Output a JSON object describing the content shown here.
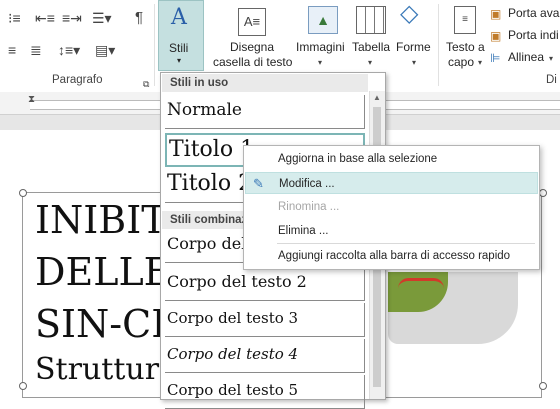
{
  "ribbon": {
    "paragraph_group_label": "Paragrafo",
    "stili_label": "Stili",
    "disegna_label_1": "Disegna",
    "disegna_label_2": "casella di testo",
    "immagini_label": "Immagini",
    "tabella_label": "Tabella",
    "forme_label": "Forme",
    "testo_label_1": "Testo a",
    "testo_label_2": "capo",
    "porta_avanti_label": "Porta avar",
    "porta_indietro_label": "Porta indi",
    "allinea_label": "Allinea",
    "pilcrow": "¶",
    "cut_group_label": "Di"
  },
  "styles_menu": {
    "section_in_use": "Stili in uso",
    "section_combined": "Stili combinaz",
    "items": [
      {
        "label": "Normale"
      },
      {
        "label": "Titolo 1"
      },
      {
        "label": "Titolo 2"
      },
      {
        "label": "Corpo del te"
      },
      {
        "label": "Corpo del testo 2"
      },
      {
        "label": "Corpo del testo 3"
      },
      {
        "label": "Corpo del testo 4"
      },
      {
        "label": "Corpo del testo 5"
      }
    ]
  },
  "context_menu": {
    "items": [
      {
        "label": "Aggiorna in base alla selezione",
        "enabled": true
      },
      {
        "label": "Modifica ...",
        "enabled": true,
        "highlighted": true
      },
      {
        "label": "Rinomina ...",
        "enabled": false
      },
      {
        "label": "Elimina ...",
        "enabled": true
      },
      {
        "label": "Aggiungi raccolta alla barra di accesso rapido",
        "enabled": true
      }
    ]
  },
  "document": {
    "lines": [
      "INIBIT",
      "DELLE",
      "SIN-CH",
      "Struttura"
    ]
  },
  "colors": {
    "accent": "#c5e0e0",
    "highlight": "#d6ecec"
  }
}
